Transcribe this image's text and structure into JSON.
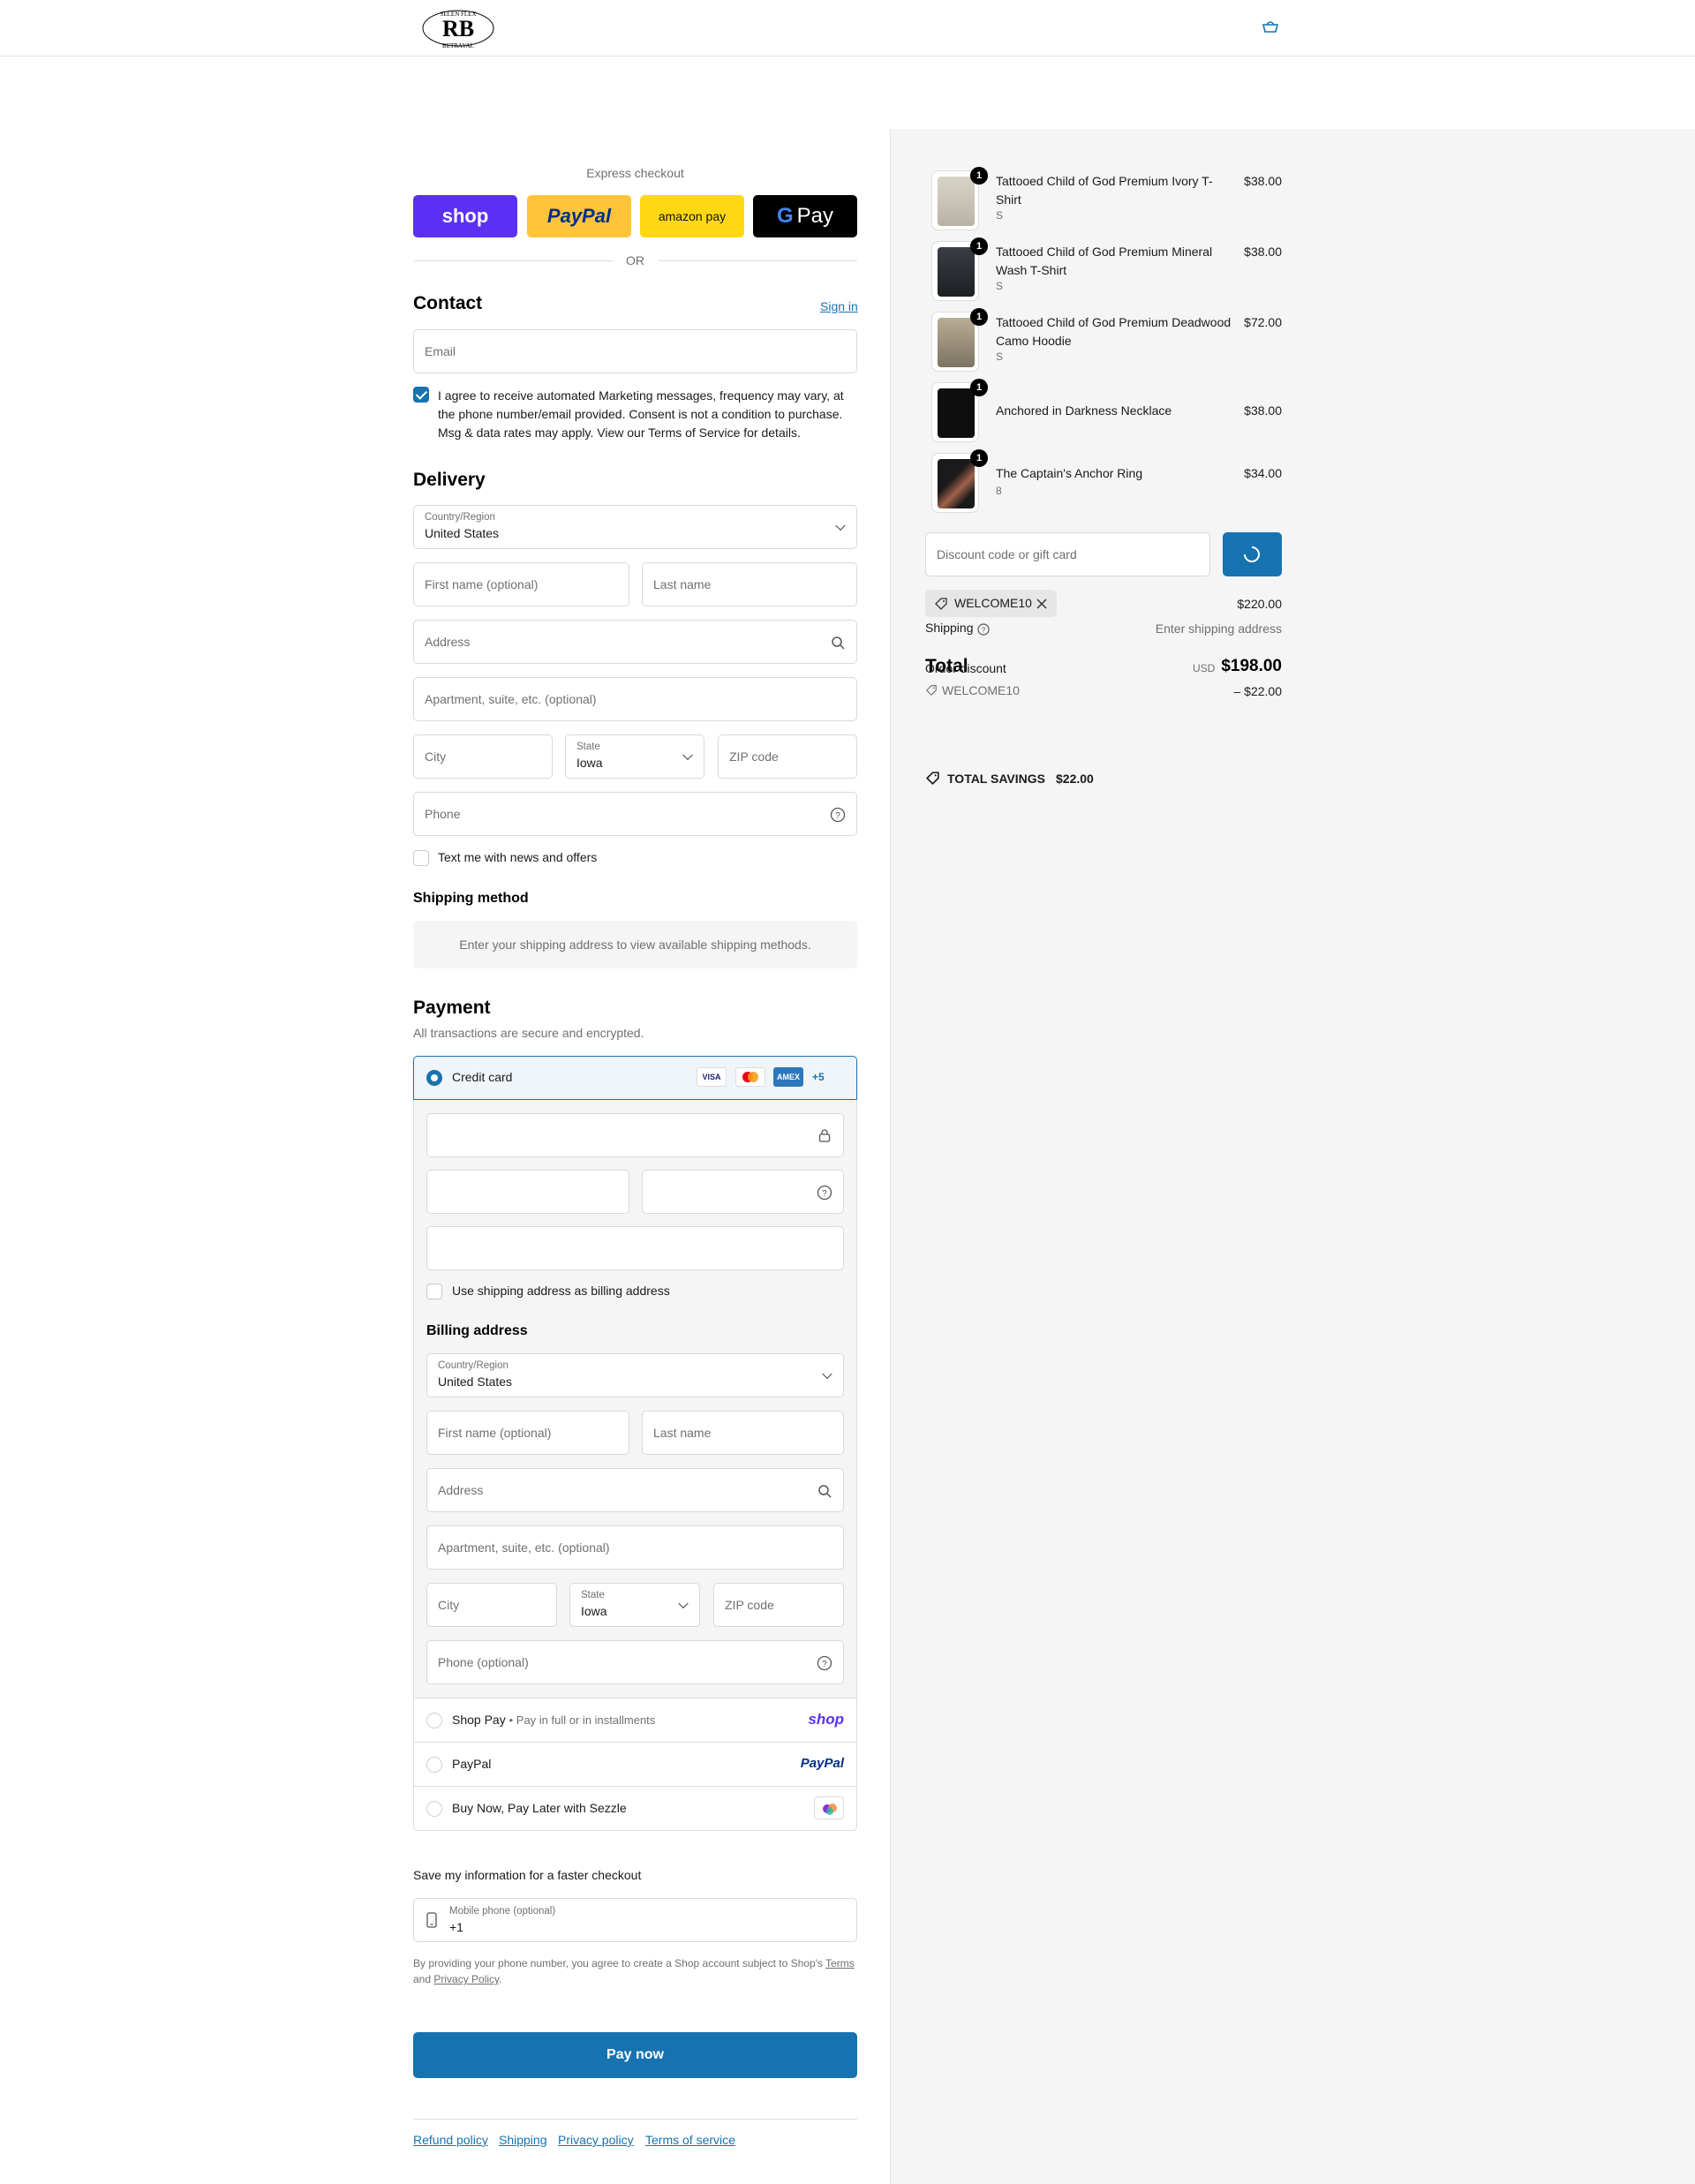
{
  "header": {
    "logo_text": "RB",
    "logo_arc_top": "SELEN FLEX",
    "logo_arc_bottom": "BETRAYAL"
  },
  "express": {
    "label": "Express checkout",
    "shop": "shop",
    "paypal": "PayPal",
    "amazon": "amazon pay",
    "gpay": "Pay",
    "or": "OR"
  },
  "contact": {
    "title": "Contact",
    "sign_in": "Sign in",
    "email_placeholder": "Email",
    "marketing_consent": "I agree to receive automated Marketing messages, frequency may vary, at the phone number/email provided. Consent is not a condition to purchase. Msg & data rates may apply. View our Terms of Service for details."
  },
  "delivery": {
    "title": "Delivery",
    "country_label": "Country/Region",
    "country_value": "United States",
    "first_name": "First name (optional)",
    "last_name": "Last name",
    "address": "Address",
    "apartment": "Apartment, suite, etc. (optional)",
    "city": "City",
    "state_label": "State",
    "state_value": "Iowa",
    "zip": "ZIP code",
    "phone": "Phone",
    "text_offers": "Text me with news and offers"
  },
  "shipping_method": {
    "title": "Shipping method",
    "message": "Enter your shipping address to view available shipping methods."
  },
  "payment": {
    "title": "Payment",
    "subtitle": "All transactions are secure and encrypted.",
    "credit_card": "Credit card",
    "visa": "VISA",
    "amex": "AMEX",
    "more_cards": "+5",
    "use_shipping": "Use shipping address as billing address",
    "billing_title": "Billing address",
    "billing": {
      "country_label": "Country/Region",
      "country_value": "United States",
      "first_name": "First name (optional)",
      "last_name": "Last name",
      "address": "Address",
      "apartment": "Apartment, suite, etc. (optional)",
      "city": "City",
      "state_label": "State",
      "state_value": "Iowa",
      "zip": "ZIP code",
      "phone": "Phone (optional)"
    },
    "shop_pay": "Shop Pay",
    "shop_pay_sub": "Pay in full or in installments",
    "shop_logo": "shop",
    "paypal": "PayPal",
    "paypal_logo": "PayPal",
    "sezzle": "Buy Now, Pay Later with Sezzle"
  },
  "save_info": {
    "title": "Save my information for a faster checkout",
    "mobile_label": "Mobile phone (optional)",
    "mobile_value": "+1",
    "legal_pre": "By providing your phone number, you agree to create a Shop account subject to Shop's",
    "terms": "Terms",
    "legal_and": "and",
    "privacy": "Privacy Policy",
    "legal_end": "."
  },
  "pay_now": "Pay now",
  "footer": {
    "refund": "Refund policy",
    "shipping": "Shipping",
    "privacy": "Privacy policy",
    "terms": "Terms of service"
  },
  "summary": {
    "items": [
      {
        "name": "Tattooed Child of God Premium Ivory T-Shirt",
        "variant": "S",
        "price": "$38.00",
        "qty": "1"
      },
      {
        "name": "Tattooed Child of God Premium Mineral Wash T-Shirt",
        "variant": "S",
        "price": "$38.00",
        "qty": "1"
      },
      {
        "name": "Tattooed Child of God Premium Deadwood Camo Hoodie",
        "variant": "S",
        "price": "$72.00",
        "qty": "1"
      },
      {
        "name": "Anchored in Darkness Necklace",
        "variant": "",
        "price": "$38.00",
        "qty": "1"
      },
      {
        "name": "The Captain's Anchor Ring",
        "variant": "8",
        "price": "$34.00",
        "qty": "1"
      }
    ],
    "discount_placeholder": "Discount code or gift card",
    "code_tag": "WELCOME10",
    "subtotal": "$220.00",
    "shipping_label": "Shipping",
    "shipping_value": "Enter shipping address",
    "total_label": "Total",
    "order_discount": "Order discount",
    "currency": "USD",
    "total_value": "$198.00",
    "discount_code": "WELCOME10",
    "discount_value": "– $22.00",
    "savings_label": "TOTAL SAVINGS",
    "savings_value": "$22.00"
  },
  "colors": {
    "accent": "#1773b0",
    "shop_purple": "#5a31f4",
    "paypal_yellow": "#ffc439",
    "amazon_yellow": "#ffd814"
  }
}
